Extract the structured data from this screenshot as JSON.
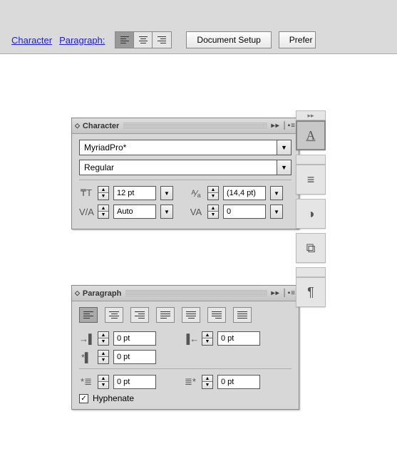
{
  "toolbar": {
    "link_character": "Character",
    "link_paragraph": "Paragraph:",
    "btn_document_setup": "Document Setup",
    "btn_preferences": "Prefer"
  },
  "character_panel": {
    "title": "Character",
    "font_family": "MyriadPro*",
    "font_style": "Regular",
    "size": "12 pt",
    "leading": "(14,4 pt)",
    "kerning": "Auto",
    "tracking": "0"
  },
  "paragraph_panel": {
    "title": "Paragraph",
    "indent_left": "0 pt",
    "indent_right": "0 pt",
    "indent_first": "0 pt",
    "space_before": "0 pt",
    "space_after": "0 pt",
    "hyphenate_label": "Hyphenate",
    "hyphenate_checked": true
  },
  "dock": {
    "items": [
      "A",
      "≡",
      "◑",
      "⧉",
      "¶"
    ]
  }
}
